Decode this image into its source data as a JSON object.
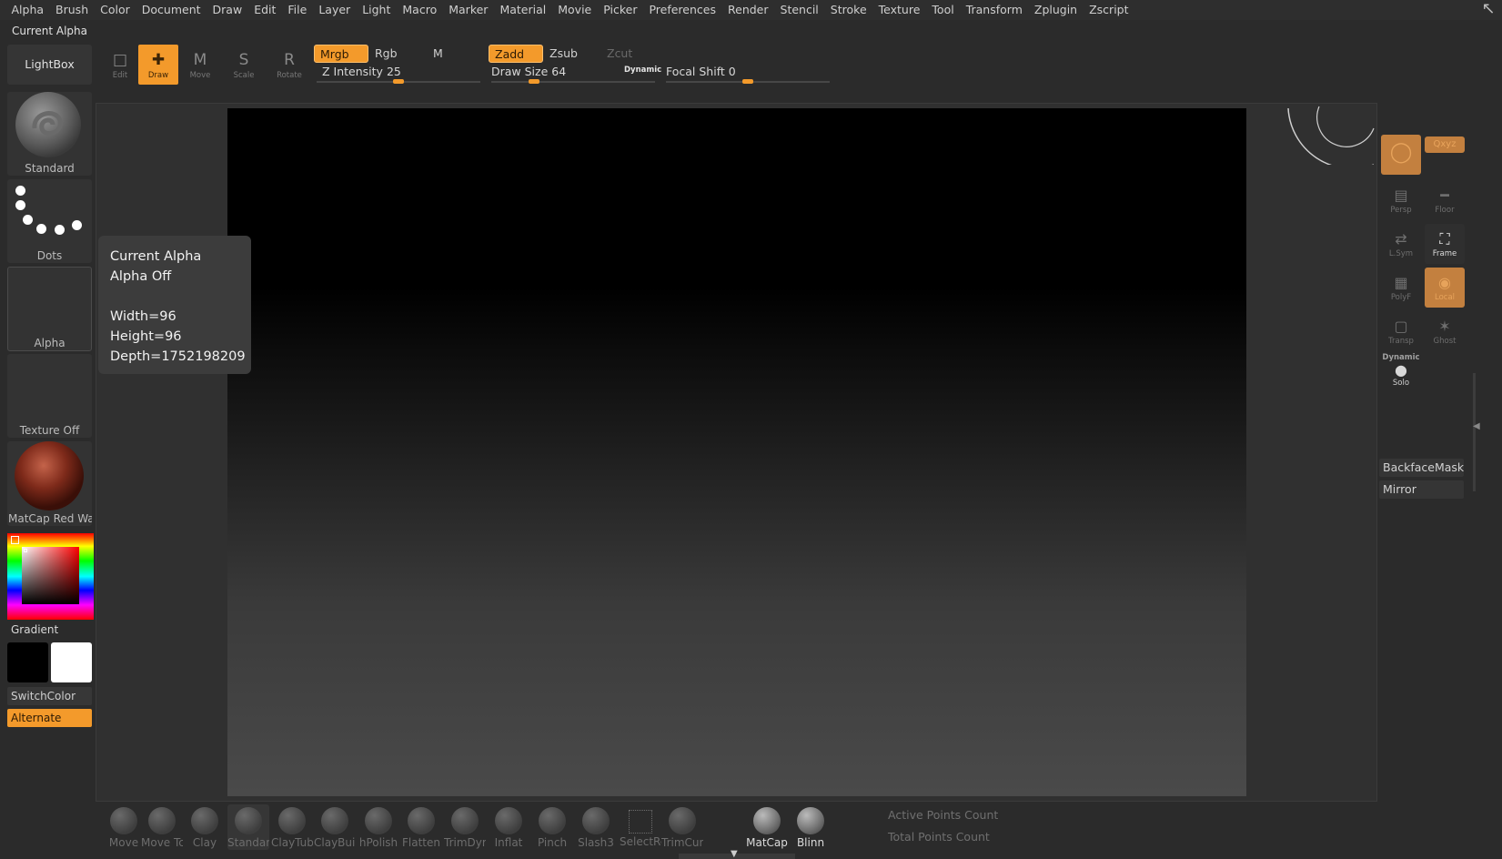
{
  "menu": [
    "Alpha",
    "Brush",
    "Color",
    "Document",
    "Draw",
    "Edit",
    "File",
    "Layer",
    "Light",
    "Macro",
    "Marker",
    "Material",
    "Movie",
    "Picker",
    "Preferences",
    "Render",
    "Stencil",
    "Stroke",
    "Texture",
    "Tool",
    "Transform",
    "Zplugin",
    "Zscript"
  ],
  "subtitle": "Current Alpha",
  "toolbar": {
    "lightbox": "LightBox",
    "edit": "Edit",
    "draw": "Draw",
    "move": "Move",
    "scale": "Scale",
    "rotate": "Rotate",
    "modes": {
      "mrgb": "Mrgb",
      "rgb": "Rgb",
      "m": "M",
      "zadd": "Zadd",
      "zsub": "Zsub",
      "zcut": "Zcut"
    },
    "z_intensity": {
      "label": "Z Intensity",
      "value": 25
    },
    "draw_size": {
      "label": "Draw Size",
      "value": 64,
      "tag": "Dynamic"
    },
    "focal_shift": {
      "label": "Focal Shift",
      "value": 0
    }
  },
  "left_panel": {
    "brush": "Standard",
    "stroke": "Dots",
    "alpha": "Alpha",
    "texture": "Texture Off",
    "material": "MatCap Red Wax",
    "gradient": "Gradient",
    "switch_color": "SwitchColor",
    "alternate": "Alternate"
  },
  "tooltip": {
    "title": "Current Alpha",
    "state": "Alpha Off",
    "width": "Width=96",
    "height": "Height=96",
    "depth": "Depth=1752198209"
  },
  "right_shelf": {
    "xyz": "Qxyz",
    "persp": "Persp",
    "floor": "Floor",
    "lsym": "L.Sym",
    "frame": "Frame",
    "polyf": "PolyF",
    "local": "Local",
    "transp": "Transp",
    "ghost": "Ghost",
    "dynamic": "Dynamic",
    "solo": "Solo",
    "backface_mask": "BackfaceMask",
    "mirror": "Mirror"
  },
  "bottom_shelf": {
    "brushes": [
      "Move",
      "Move Tc",
      "Clay",
      "Standar",
      "ClayTub",
      "ClayBuil",
      "hPolish",
      "Flatten",
      "TrimDyr",
      "Inflat",
      "Pinch",
      "Slash3",
      "SelectRe",
      "TrimCur"
    ],
    "materials": [
      "MatCap",
      "Blinn"
    ],
    "active_points": "Active Points Count",
    "total_points": "Total Points Count"
  },
  "colors": {
    "accent": "#f39a2b",
    "background": "#2b2b2b",
    "main_color": "#000000",
    "secondary_color": "#ffffff"
  }
}
